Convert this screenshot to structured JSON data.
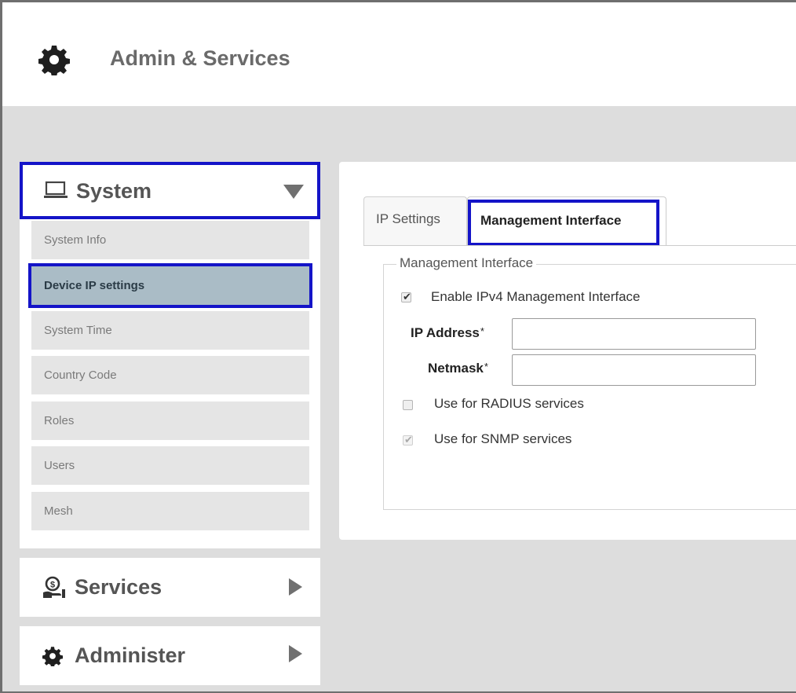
{
  "header": {
    "title": "Admin & Services",
    "icon": "gear-icon"
  },
  "sidebar": {
    "system": {
      "label": "System",
      "icon": "laptop-icon",
      "items": [
        {
          "label": "System Info"
        },
        {
          "label": "Device IP settings",
          "active": true
        },
        {
          "label": "System Time"
        },
        {
          "label": "Country Code"
        },
        {
          "label": "Roles"
        },
        {
          "label": "Users"
        },
        {
          "label": "Mesh"
        }
      ]
    },
    "services": {
      "label": "Services",
      "icon": "services-icon"
    },
    "administer": {
      "label": "Administer",
      "icon": "gear-icon"
    }
  },
  "tabs": [
    {
      "label": "IP Settings"
    },
    {
      "label": "Management Interface",
      "active": true
    }
  ],
  "form": {
    "legend": "Management Interface",
    "enable_ipv4": {
      "label": "Enable IPv4 Management Interface",
      "checked": true
    },
    "ip_address": {
      "label": "IP Address",
      "required_mark": "*",
      "value": ""
    },
    "netmask": {
      "label": "Netmask",
      "required_mark": "*",
      "value": ""
    },
    "radius": {
      "label": "Use for RADIUS services",
      "checked": false
    },
    "snmp": {
      "label": "Use for SNMP services",
      "checked": true,
      "disabled": true
    }
  },
  "colors": {
    "highlight": "#1414c8",
    "active_item": "#aabcc6",
    "content_bg": "#dddddd"
  }
}
